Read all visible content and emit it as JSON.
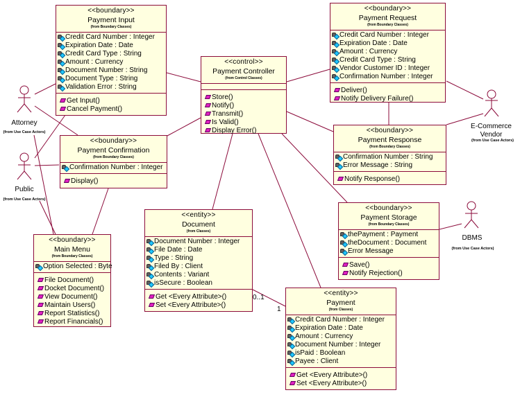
{
  "colors": {
    "line": "#8b0a3a",
    "class_fill": "#ffffe0",
    "op_icon": "#e020c0",
    "attr_icon": "#1ec8ff"
  },
  "classes": {
    "payment_input": {
      "stereotype": "<<boundary>>",
      "name": "Payment Input",
      "from": "(from Boundary Classes)",
      "attributes": [
        "Credit Card Number : Integer",
        "Expiration Date : Date",
        "Credit Card Type : String",
        "Amount : Currency",
        "Document Number : String",
        "Document Type : String",
        "Validation Error : String"
      ],
      "operations": [
        "Get Input()",
        "Cancel Payment()"
      ]
    },
    "payment_controller": {
      "stereotype": "<<control>>",
      "name": "Payment Controller",
      "from": "(from Control Classes)",
      "attributes": [],
      "operations": [
        "Store()",
        "Notify()",
        "Transmit()",
        "Is Valid()",
        "Display Error()"
      ]
    },
    "payment_request": {
      "stereotype": "<<boundary>>",
      "name": "Payment Request",
      "from": "(from Boundary Classes)",
      "attributes": [
        "Credit Card Number : Integer",
        "Expiration Date : Date",
        "Amount : Currency",
        "Credit Card Type : String",
        "Vendor Customer ID : Integer",
        "Confirmation Number : Integer"
      ],
      "operations": [
        "Deliver()",
        "Notify Delivery Failure()"
      ]
    },
    "payment_response": {
      "stereotype": "<<boundary>>",
      "name": "Payment Response",
      "from": "(from Boundary Classes)",
      "attributes": [
        "Confirmation Number : String",
        "Error Message : String"
      ],
      "operations": [
        "Notify Response()"
      ]
    },
    "payment_confirmation": {
      "stereotype": "<<boundary>>",
      "name": "Payment Confirmation",
      "from": "(from Boundary Classes)",
      "attributes": [
        "Confirmation Number : Integer"
      ],
      "operations": [
        "Display()"
      ]
    },
    "payment_storage": {
      "stereotype": "<<boundary>>",
      "name": "Payment Storage",
      "from": "(from Boundary Classes)",
      "attributes": [
        "thePayment : Payment",
        "theDocument : Document",
        "Error Message"
      ],
      "operations": [
        "Save()",
        "Notify Rejection()"
      ]
    },
    "main_menu": {
      "stereotype": "<<boundary>>",
      "name": "Main Menu",
      "from": "(from Boundary Classes)",
      "attributes": [
        "Option Selected : Byte"
      ],
      "operations": [
        "File Document()",
        "Docket Document()",
        "View Document()",
        "Maintain Users()",
        "Report Statistics()",
        "Report Financials()"
      ]
    },
    "document": {
      "stereotype": "<<entity>>",
      "name": "Document",
      "from": "(from Classes)",
      "attributes": [
        "Document Number : Integer",
        "File Date : Date",
        "Type : String",
        "Filed By : Client",
        "Contents : Variant",
        "isSecure : Boolean"
      ],
      "operations": [
        "Get <Every Attribute>()",
        "Set <Every Attribute>()"
      ]
    },
    "payment": {
      "stereotype": "<<entity>>",
      "name": "Payment",
      "from": "(from Classes)",
      "attributes": [
        "Credit Card Number : Integer",
        "Expiration Date : Date",
        "Amount : Currency",
        "Document Number : Integer",
        "isPaid : Boolean",
        "Payee : Client"
      ],
      "operations": [
        "Get <Every Attribute>()",
        "Set <Every Attribute>()"
      ]
    }
  },
  "actors": {
    "attorney": {
      "label": "Attorney",
      "from": "(from Use Case Actors)"
    },
    "public": {
      "label": "Public",
      "from": "(from Use Case Actors)"
    },
    "ecommerce_vendor": {
      "label": "E-Commerce Vendor",
      "label_line1": "E-Commerce",
      "label_line2": "Vendor",
      "from": "(from Use Case Actors)"
    },
    "dbms": {
      "label": "DBMS",
      "from": "(from Use Case Actors)"
    }
  },
  "associations": [
    {
      "from": "attorney",
      "to": "payment_input"
    },
    {
      "from": "attorney",
      "to": "payment_confirmation"
    },
    {
      "from": "attorney",
      "to": "main_menu"
    },
    {
      "from": "public",
      "to": "payment_input"
    },
    {
      "from": "public",
      "to": "payment_confirmation"
    },
    {
      "from": "public",
      "to": "main_menu"
    },
    {
      "from": "payment_input",
      "to": "payment_controller"
    },
    {
      "from": "payment_confirmation",
      "to": "payment_controller"
    },
    {
      "from": "payment_confirmation",
      "to": "main_menu"
    },
    {
      "from": "payment_controller",
      "to": "payment_request"
    },
    {
      "from": "payment_controller",
      "to": "payment_response"
    },
    {
      "from": "payment_controller",
      "to": "payment_storage"
    },
    {
      "from": "payment_controller",
      "to": "document"
    },
    {
      "from": "payment_controller",
      "to": "payment"
    },
    {
      "from": "payment_request",
      "to": "payment_response"
    },
    {
      "from": "payment_request",
      "to": "ecommerce_vendor"
    },
    {
      "from": "payment_response",
      "to": "ecommerce_vendor"
    },
    {
      "from": "payment_storage",
      "to": "dbms"
    },
    {
      "from": "document",
      "to": "payment",
      "mult_from": "0..1",
      "mult_to": "1"
    }
  ],
  "multiplicities": {
    "document_end": "0..1",
    "payment_end": "1"
  }
}
